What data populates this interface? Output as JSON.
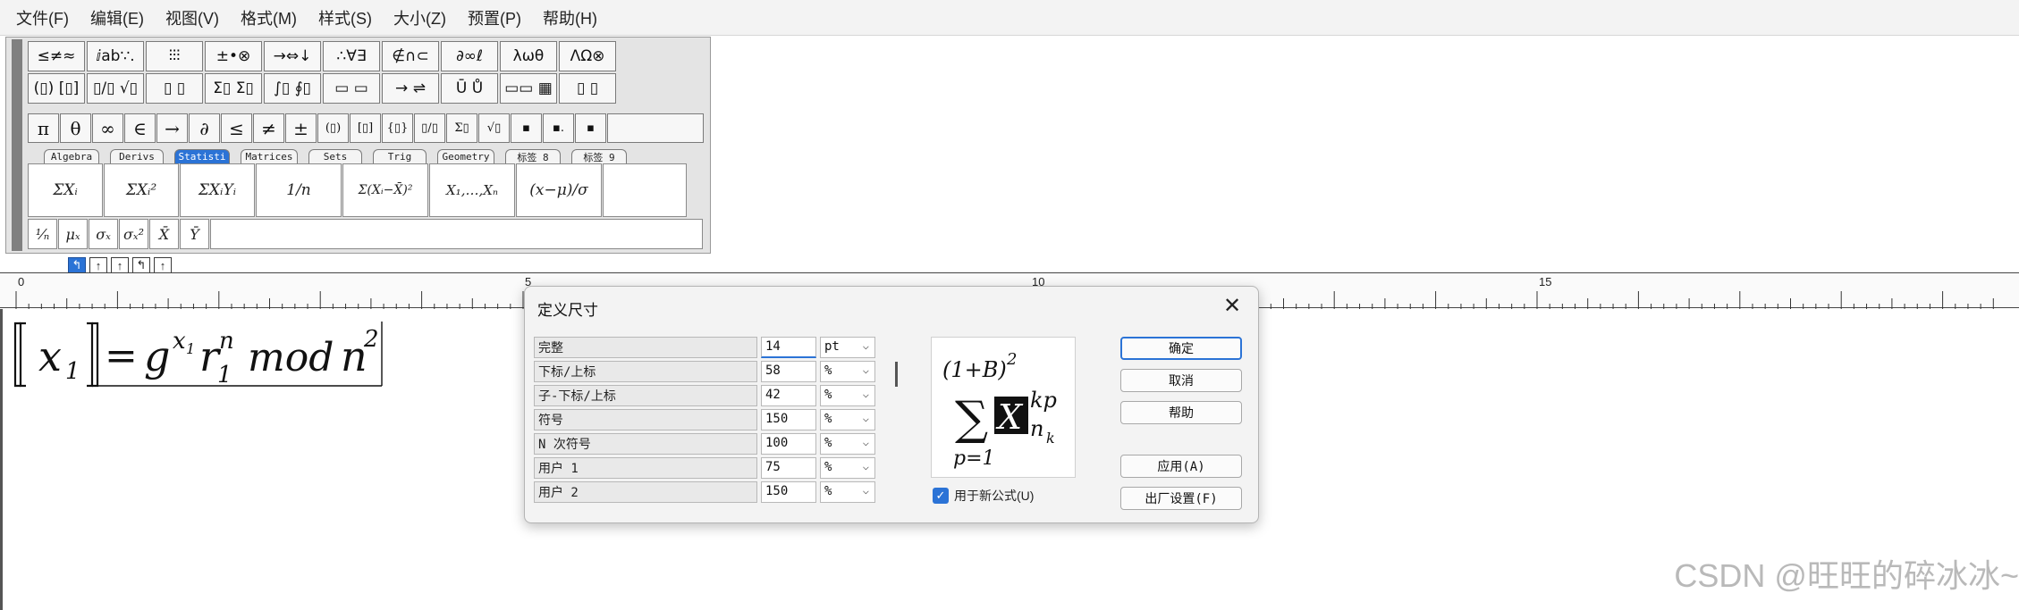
{
  "menubar": {
    "items": [
      "文件(F)",
      "编辑(E)",
      "视图(V)",
      "格式(M)",
      "样式(S)",
      "大小(Z)",
      "预置(P)",
      "帮助(H)"
    ]
  },
  "palette": {
    "row1": [
      "≤≠≈",
      "ⅈab∵.",
      "⫶⫶⫶",
      "±•⊗",
      "→⇔↓",
      "∴∀∃",
      "∉∩⊂",
      "∂∞ℓ",
      "λωθ",
      "ΛΩ⊗"
    ],
    "row2": [
      "(▯) [▯]",
      "▯/▯ √▯",
      "▯ ▯",
      "Σ▯ Σ▯",
      "∫▯ ∮▯",
      "▭ ▭",
      "→ ⇌",
      "Ū Ů",
      "▭▭ ▦",
      "▯ ▯"
    ],
    "symbols": [
      "π",
      "θ",
      "∞",
      "∈",
      "→",
      "∂",
      "≤",
      "≠",
      "±",
      "(▯)",
      "[▯]",
      "{▯}",
      "▯/▯",
      "Σ▯",
      "√▯",
      "▪",
      "▪.",
      "▪"
    ],
    "tabs": [
      "Algebra",
      "Derivs",
      "Statisti",
      "Matrices",
      "Sets",
      "Trig",
      "Geometry",
      "标签 8",
      "标签 9"
    ],
    "active_tab": "Statisti",
    "templates": [
      "ΣXᵢ",
      "ΣXᵢ²",
      "ΣXᵢYᵢ",
      "1/n",
      "Σ(Xᵢ−X̄)²",
      "X₁,…,Xₙ",
      "(x−μ)/σ",
      ""
    ],
    "small_templates": [
      "¹⁄ₙ",
      "μₓ",
      "σₓ",
      "σₓ²",
      "X̄",
      "Ȳ"
    ],
    "mini_buttons": [
      "↰",
      "↑",
      "↑",
      "↰",
      "↑"
    ]
  },
  "ruler": {
    "labels": [
      "0",
      "5",
      "10",
      "15"
    ]
  },
  "document": {
    "formula_parts": {
      "lhs": "x",
      "lhs_sub": "1",
      "eq": "=",
      "g": "g",
      "sup_x": "x",
      "sup_sub": "1",
      "r": "r",
      "r_sub": "1",
      "r_sup": "n",
      "mod": "mod",
      "n": "n",
      "n_sup": "2"
    }
  },
  "dialog": {
    "title": "定义尺寸",
    "rows": [
      {
        "name": "完整",
        "value": "14",
        "unit": "pt"
      },
      {
        "name": "下标/上标",
        "value": "58",
        "unit": "%"
      },
      {
        "name": "子-下标/上标",
        "value": "42",
        "unit": "%"
      },
      {
        "name": "符号",
        "value": "150",
        "unit": "%"
      },
      {
        "name": "N 次符号",
        "value": "100",
        "unit": "%"
      },
      {
        "name": "用户 1",
        "value": "75",
        "unit": "%"
      },
      {
        "name": "用户 2",
        "value": "150",
        "unit": "%"
      }
    ],
    "preview": {
      "top": "(1+B)",
      "top_sup": "2",
      "sum": "∑",
      "X": "X",
      "sup": "kp",
      "sub_n": "n",
      "sub_k": "k",
      "bottom": "p=1"
    },
    "checkbox_label": "用于新公式(U)",
    "checkbox_checked": true,
    "buttons": {
      "ok": "确定",
      "cancel": "取消",
      "help": "帮助",
      "apply": "应用(A)",
      "factory": "出厂设置(F)"
    }
  },
  "watermark": "CSDN @旺旺的碎冰冰~"
}
